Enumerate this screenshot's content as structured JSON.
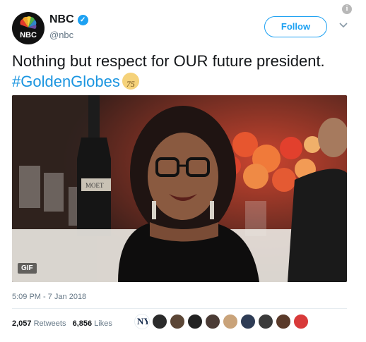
{
  "header": {
    "name": "NBC",
    "handle": "@nbc",
    "avatar_label": "NBC",
    "follow_label": "Follow",
    "info_glyph": "i"
  },
  "tweet": {
    "text_plain": "Nothing but respect for OUR future president. ",
    "hashtag": "#GoldenGlobes",
    "emoji_text": "75"
  },
  "media": {
    "badge": "GIF",
    "bottle_label": "MOET"
  },
  "footer": {
    "timestamp": "5:09 PM - 7 Jan 2018",
    "retweets_count": "2,057",
    "retweets_label": "Retweets",
    "likes_count": "6,856",
    "likes_label": "Likes"
  },
  "colors": {
    "accent": "#1da1f2",
    "hashtag": "#1b95e0",
    "muted": "#657786"
  },
  "likers": [
    {
      "icon": "yankees-logo-avatar",
      "color": "#ffffff"
    },
    {
      "icon": "user-avatar",
      "color": "#2b2b2b"
    },
    {
      "icon": "user-avatar",
      "color": "#5b4636"
    },
    {
      "icon": "user-avatar",
      "color": "#222222"
    },
    {
      "icon": "user-avatar",
      "color": "#4a3b35"
    },
    {
      "icon": "user-avatar",
      "color": "#c9a37a"
    },
    {
      "icon": "user-avatar",
      "color": "#2e3c55"
    },
    {
      "icon": "user-avatar",
      "color": "#3a3a3a"
    },
    {
      "icon": "user-avatar",
      "color": "#5a3a2a"
    },
    {
      "icon": "user-avatar",
      "color": "#d83a3a"
    }
  ]
}
